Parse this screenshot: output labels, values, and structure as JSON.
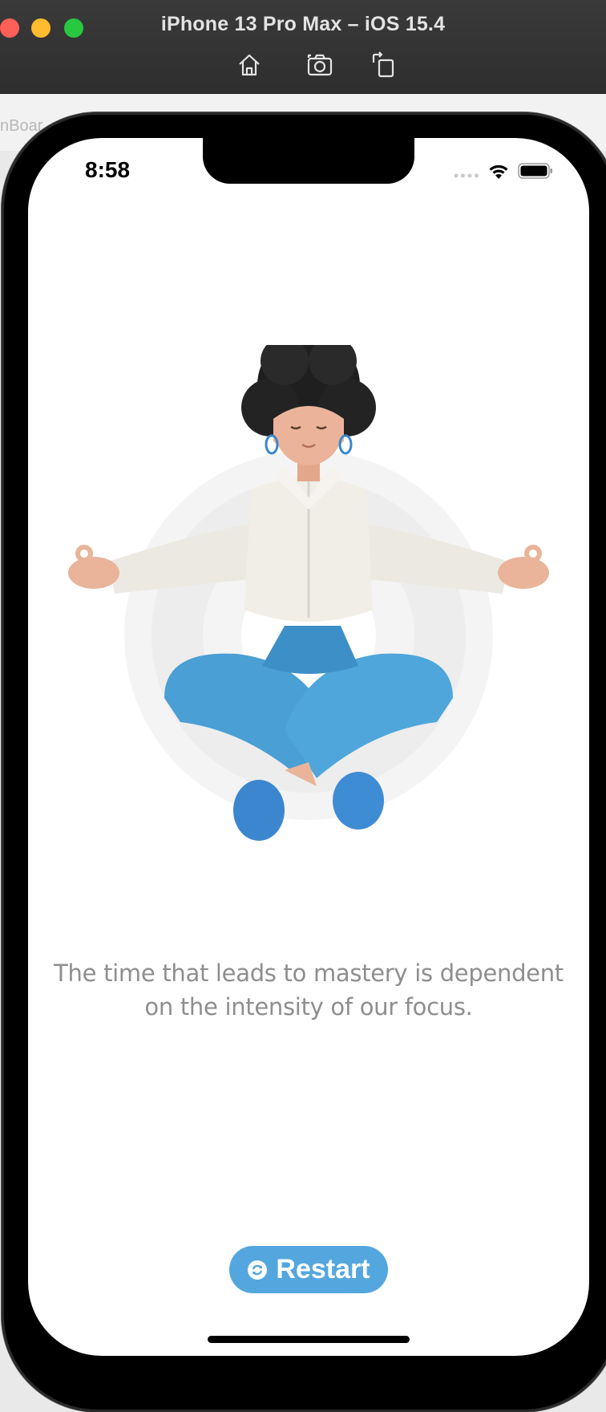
{
  "window": {
    "title": "iPhone 13 Pro Max – iOS 15.4",
    "toolbar": [
      {
        "name": "home",
        "icon": "home-icon"
      },
      {
        "name": "screenshot",
        "icon": "camera-icon"
      },
      {
        "name": "rotate",
        "icon": "rotate-icon"
      }
    ],
    "backdrop_text": "nBoar"
  },
  "status_bar": {
    "time": "8:58",
    "icons": [
      "signal-dots-icon",
      "wifi-icon",
      "battery-icon"
    ]
  },
  "content": {
    "illustration": "meditating-person-illustration",
    "quote": "The time that leads to mastery is dependent on the intensity of our focus."
  },
  "actions": {
    "restart_label": "Restart",
    "restart_icon": "restart-icon"
  },
  "colors": {
    "accent": "#54a7de",
    "quote_text": "#8e8e8e"
  }
}
